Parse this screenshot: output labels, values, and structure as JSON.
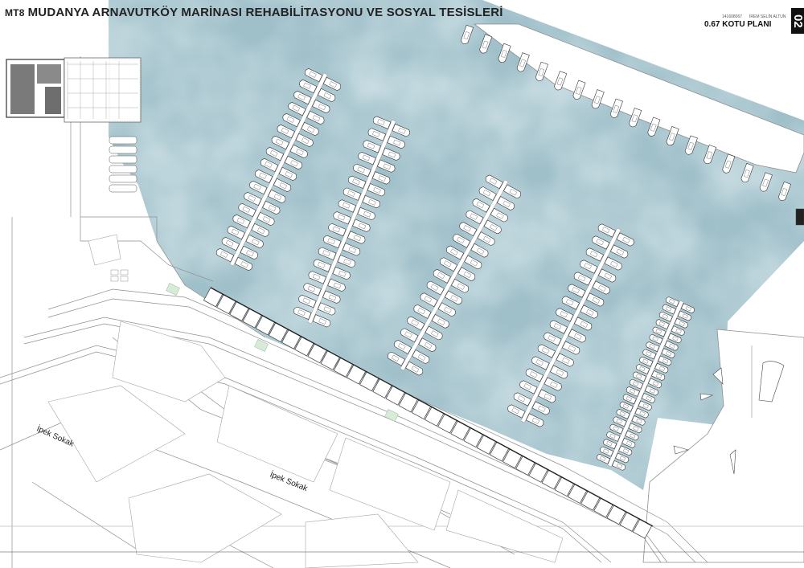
{
  "title": {
    "code": "MT8",
    "main": "MUDANYA ARNAVUTKÖY MARİNASI REHABİLİTASYONU VE SOSYAL TESİSLERİ"
  },
  "header": {
    "student_id": "141608067",
    "student_name": "İREM SELİN ALTUN",
    "plan_title": "0.67 KOTU PLANI",
    "sheet_number": "02"
  },
  "streets": [
    "İpek Sokak",
    "İpek Sokak"
  ],
  "icons": {
    "north_arrow": "north-arrow-icon",
    "boat": "boat-icon"
  },
  "colors": {
    "water": "#9fbfc9",
    "water_dark": "#7fa3b0",
    "water_light": "#c3d8de",
    "land": "#ffffff",
    "lines": "#8e8e8e",
    "buildings": "#4a4a4a",
    "green": "#d8ead8"
  }
}
